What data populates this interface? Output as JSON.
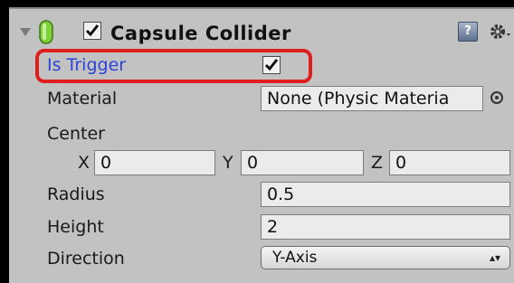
{
  "component": {
    "title": "Capsule Collider",
    "enabled": true
  },
  "properties": {
    "is_trigger_label": "Is Trigger",
    "is_trigger_checked": true,
    "material_label": "Material",
    "material_value": "None (Physic Materiа",
    "center_label": "Center",
    "center": {
      "x_label": "X",
      "x_value": "0",
      "y_label": "Y",
      "y_value": "0",
      "z_label": "Z",
      "z_value": "0"
    },
    "radius_label": "Radius",
    "radius_value": "0.5",
    "height_label": "Height",
    "height_value": "2",
    "direction_label": "Direction",
    "direction_value": "Y-Axis"
  },
  "icons": {
    "fold": "triangle-down-icon",
    "component": "capsule-icon",
    "help": "help-book-icon",
    "settings": "gear-icon",
    "object_picker": "object-picker-icon",
    "dropdown": "updown-arrows-icon"
  },
  "colors": {
    "panel_bg": "#c2c2c2",
    "field_bg": "#ebebeb",
    "trigger_label": "#2d42d6",
    "highlight": "#e01e1e",
    "capsule": "#7fd13b"
  }
}
